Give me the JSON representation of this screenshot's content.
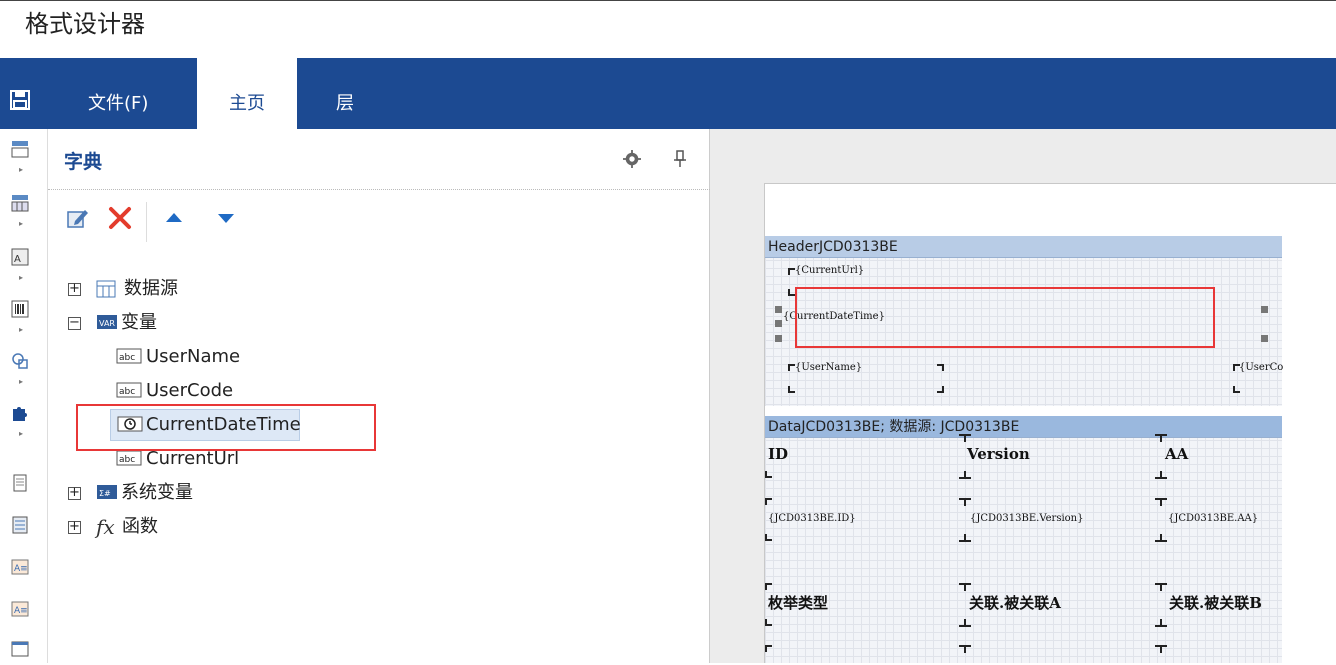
{
  "window": {
    "title": "格式设计器"
  },
  "ribbon": {
    "tabs": [
      {
        "label": "文件(F)"
      },
      {
        "label": "主页"
      },
      {
        "label": "层"
      }
    ],
    "active_tab": "主页",
    "accent": "#1c4a92"
  },
  "dictionary": {
    "title": "字典",
    "tree": [
      {
        "label": "数据源",
        "expander": "+"
      },
      {
        "label": "变量",
        "expander": "−"
      },
      {
        "label": "UserName"
      },
      {
        "label": "UserCode"
      },
      {
        "label": "CurrentDateTime",
        "selected": true
      },
      {
        "label": "CurrentUrl"
      },
      {
        "label": "系统变量",
        "expander": "+"
      },
      {
        "label": "函数",
        "expander": "+"
      }
    ]
  },
  "report": {
    "header_band": {
      "title": "HeaderJCD0313BE",
      "fields": [
        "{CurrentUrl}",
        "{CurrentDateTime}",
        "{UserName}",
        "{UserCo"
      ]
    },
    "data_band": {
      "title": "DataJCD0313BE; 数据源: JCD0313BE",
      "col_headers": [
        "ID",
        "Version",
        "AA"
      ],
      "col_values": [
        "{JCD0313BE.ID}",
        "{JCD0313BE.Version}",
        "{JCD0313BE.AA}"
      ],
      "row2_headers": [
        "枚举类型",
        "关联.被关联A",
        "关联.被关联B"
      ]
    }
  },
  "highlight_color": "#e83737"
}
